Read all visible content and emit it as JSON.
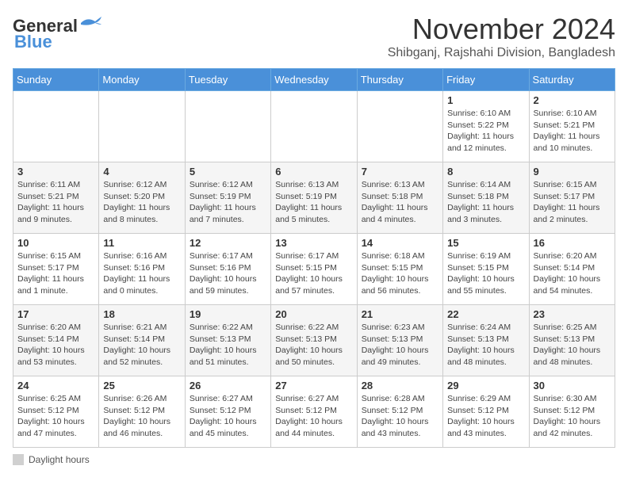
{
  "logo": {
    "line1": "General",
    "line2": "Blue"
  },
  "header": {
    "month_year": "November 2024",
    "location": "Shibganj, Rajshahi Division, Bangladesh"
  },
  "days_of_week": [
    "Sunday",
    "Monday",
    "Tuesday",
    "Wednesday",
    "Thursday",
    "Friday",
    "Saturday"
  ],
  "weeks": [
    [
      {
        "day": "",
        "info": ""
      },
      {
        "day": "",
        "info": ""
      },
      {
        "day": "",
        "info": ""
      },
      {
        "day": "",
        "info": ""
      },
      {
        "day": "",
        "info": ""
      },
      {
        "day": "1",
        "info": "Sunrise: 6:10 AM\nSunset: 5:22 PM\nDaylight: 11 hours and 12 minutes."
      },
      {
        "day": "2",
        "info": "Sunrise: 6:10 AM\nSunset: 5:21 PM\nDaylight: 11 hours and 10 minutes."
      }
    ],
    [
      {
        "day": "3",
        "info": "Sunrise: 6:11 AM\nSunset: 5:21 PM\nDaylight: 11 hours and 9 minutes."
      },
      {
        "day": "4",
        "info": "Sunrise: 6:12 AM\nSunset: 5:20 PM\nDaylight: 11 hours and 8 minutes."
      },
      {
        "day": "5",
        "info": "Sunrise: 6:12 AM\nSunset: 5:19 PM\nDaylight: 11 hours and 7 minutes."
      },
      {
        "day": "6",
        "info": "Sunrise: 6:13 AM\nSunset: 5:19 PM\nDaylight: 11 hours and 5 minutes."
      },
      {
        "day": "7",
        "info": "Sunrise: 6:13 AM\nSunset: 5:18 PM\nDaylight: 11 hours and 4 minutes."
      },
      {
        "day": "8",
        "info": "Sunrise: 6:14 AM\nSunset: 5:18 PM\nDaylight: 11 hours and 3 minutes."
      },
      {
        "day": "9",
        "info": "Sunrise: 6:15 AM\nSunset: 5:17 PM\nDaylight: 11 hours and 2 minutes."
      }
    ],
    [
      {
        "day": "10",
        "info": "Sunrise: 6:15 AM\nSunset: 5:17 PM\nDaylight: 11 hours and 1 minute."
      },
      {
        "day": "11",
        "info": "Sunrise: 6:16 AM\nSunset: 5:16 PM\nDaylight: 11 hours and 0 minutes."
      },
      {
        "day": "12",
        "info": "Sunrise: 6:17 AM\nSunset: 5:16 PM\nDaylight: 10 hours and 59 minutes."
      },
      {
        "day": "13",
        "info": "Sunrise: 6:17 AM\nSunset: 5:15 PM\nDaylight: 10 hours and 57 minutes."
      },
      {
        "day": "14",
        "info": "Sunrise: 6:18 AM\nSunset: 5:15 PM\nDaylight: 10 hours and 56 minutes."
      },
      {
        "day": "15",
        "info": "Sunrise: 6:19 AM\nSunset: 5:15 PM\nDaylight: 10 hours and 55 minutes."
      },
      {
        "day": "16",
        "info": "Sunrise: 6:20 AM\nSunset: 5:14 PM\nDaylight: 10 hours and 54 minutes."
      }
    ],
    [
      {
        "day": "17",
        "info": "Sunrise: 6:20 AM\nSunset: 5:14 PM\nDaylight: 10 hours and 53 minutes."
      },
      {
        "day": "18",
        "info": "Sunrise: 6:21 AM\nSunset: 5:14 PM\nDaylight: 10 hours and 52 minutes."
      },
      {
        "day": "19",
        "info": "Sunrise: 6:22 AM\nSunset: 5:13 PM\nDaylight: 10 hours and 51 minutes."
      },
      {
        "day": "20",
        "info": "Sunrise: 6:22 AM\nSunset: 5:13 PM\nDaylight: 10 hours and 50 minutes."
      },
      {
        "day": "21",
        "info": "Sunrise: 6:23 AM\nSunset: 5:13 PM\nDaylight: 10 hours and 49 minutes."
      },
      {
        "day": "22",
        "info": "Sunrise: 6:24 AM\nSunset: 5:13 PM\nDaylight: 10 hours and 48 minutes."
      },
      {
        "day": "23",
        "info": "Sunrise: 6:25 AM\nSunset: 5:13 PM\nDaylight: 10 hours and 48 minutes."
      }
    ],
    [
      {
        "day": "24",
        "info": "Sunrise: 6:25 AM\nSunset: 5:12 PM\nDaylight: 10 hours and 47 minutes."
      },
      {
        "day": "25",
        "info": "Sunrise: 6:26 AM\nSunset: 5:12 PM\nDaylight: 10 hours and 46 minutes."
      },
      {
        "day": "26",
        "info": "Sunrise: 6:27 AM\nSunset: 5:12 PM\nDaylight: 10 hours and 45 minutes."
      },
      {
        "day": "27",
        "info": "Sunrise: 6:27 AM\nSunset: 5:12 PM\nDaylight: 10 hours and 44 minutes."
      },
      {
        "day": "28",
        "info": "Sunrise: 6:28 AM\nSunset: 5:12 PM\nDaylight: 10 hours and 43 minutes."
      },
      {
        "day": "29",
        "info": "Sunrise: 6:29 AM\nSunset: 5:12 PM\nDaylight: 10 hours and 43 minutes."
      },
      {
        "day": "30",
        "info": "Sunrise: 6:30 AM\nSunset: 5:12 PM\nDaylight: 10 hours and 42 minutes."
      }
    ]
  ],
  "legend": {
    "label": "Daylight hours"
  }
}
